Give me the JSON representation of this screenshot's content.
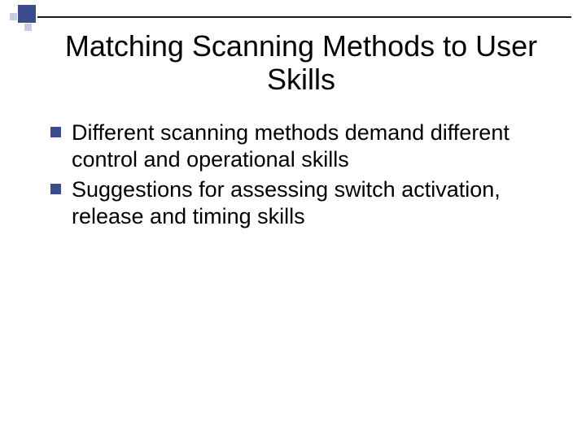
{
  "slide": {
    "title": "Matching Scanning Methods to User Skills",
    "bullets": [
      "Different scanning methods demand different control and operational skills",
      "Suggestions for assessing switch activation, release and timing skills"
    ]
  }
}
